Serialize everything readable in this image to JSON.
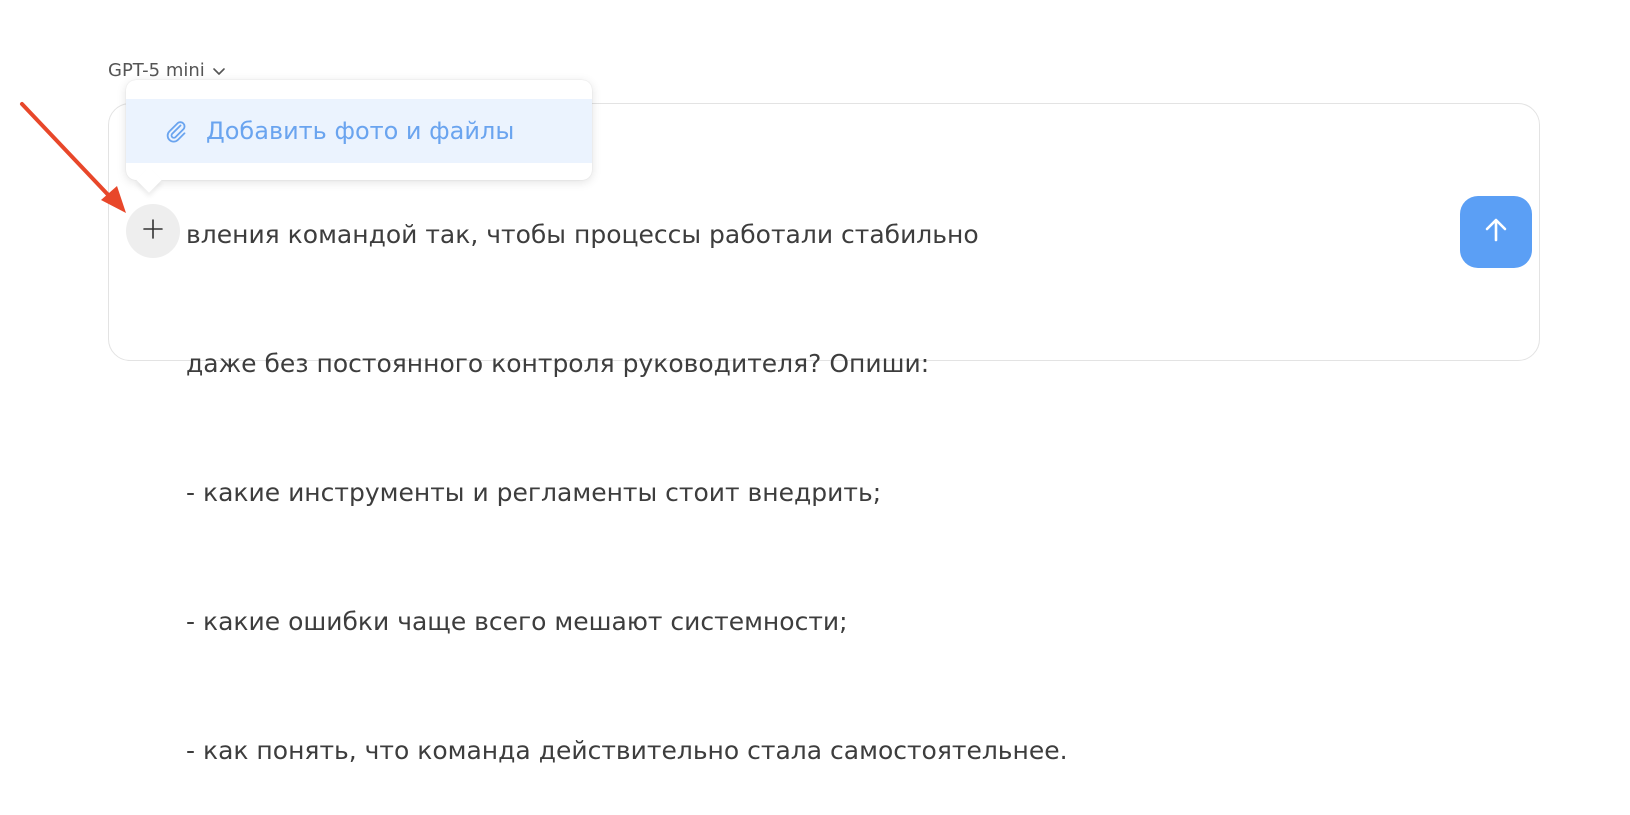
{
  "model_selector": {
    "label": "GPT-5 mini",
    "icon": "chevron-down-icon"
  },
  "composer": {
    "visible_lines": [
      "вления командой так, чтобы процессы работали стабильно",
      "даже без постоянного контроля руководителя? Опиши:",
      "- какие инструменты и регламенты стоит внедрить;",
      "- какие ошибки чаще всего мешают системности;",
      "- как понять, что команда действительно стала самостоятельнее."
    ],
    "plus_icon": "plus-icon",
    "send_icon": "arrow-up-icon"
  },
  "popup": {
    "item_label": "Добавить фото и файлы",
    "item_icon": "paperclip-icon"
  },
  "annotation": {
    "arrow_color": "#e8472a"
  },
  "colors": {
    "send_button": "#5b9ff5",
    "popup_highlight": "#ebf3fe",
    "popup_text": "#6aa4ef"
  }
}
